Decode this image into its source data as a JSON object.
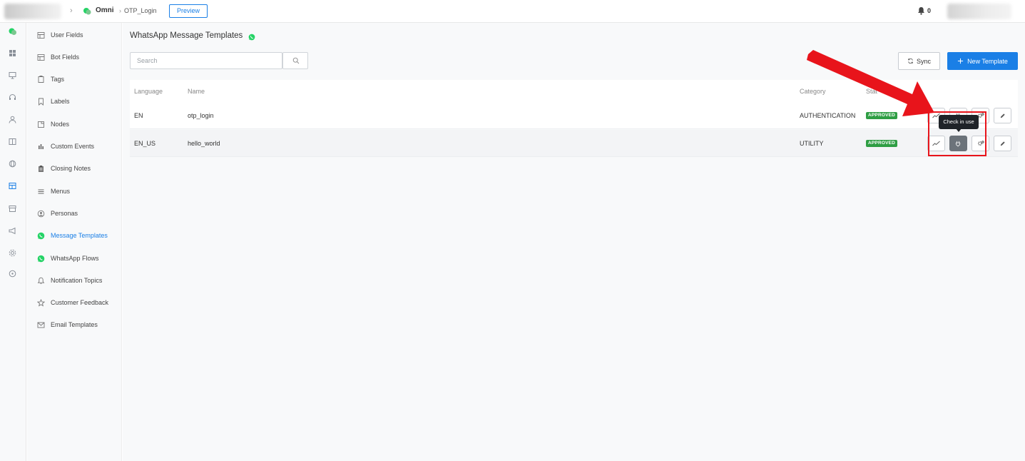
{
  "topbar": {
    "breadcrumb_app": "Omni",
    "breadcrumb_page": "OTP_Login",
    "preview_label": "Preview",
    "notification_count": "0"
  },
  "sidebar": {
    "items": [
      {
        "label": "User Fields",
        "icon": "table-icon"
      },
      {
        "label": "Bot Fields",
        "icon": "table-icon"
      },
      {
        "label": "Tags",
        "icon": "tag-icon"
      },
      {
        "label": "Labels",
        "icon": "bookmark-icon"
      },
      {
        "label": "Nodes",
        "icon": "node-icon"
      },
      {
        "label": "Custom Events",
        "icon": "bar-chart-icon"
      },
      {
        "label": "Closing Notes",
        "icon": "clipboard-icon"
      },
      {
        "label": "Menus",
        "icon": "menu-icon"
      },
      {
        "label": "Personas",
        "icon": "persona-icon"
      },
      {
        "label": "Message Templates",
        "icon": "whatsapp-icon",
        "active": true
      },
      {
        "label": "WhatsApp Flows",
        "icon": "whatsapp-icon"
      },
      {
        "label": "Notification Topics",
        "icon": "bell-icon"
      },
      {
        "label": "Customer Feedback",
        "icon": "star-icon"
      },
      {
        "label": "Email Templates",
        "icon": "mail-icon"
      }
    ]
  },
  "main": {
    "title": "WhatsApp Message Templates",
    "search_placeholder": "Search",
    "sync_label": "Sync",
    "new_template_label": "New Template",
    "columns": {
      "language": "Language",
      "name": "Name",
      "category": "Category",
      "status": "Stat"
    },
    "rows": [
      {
        "language": "EN",
        "name": "otp_login",
        "category": "AUTHENTICATION",
        "status": "APPROVED"
      },
      {
        "language": "EN_US",
        "name": "hello_world",
        "category": "UTILITY",
        "status": "APPROVED"
      }
    ],
    "tooltip": "Check in use"
  },
  "colors": {
    "accent": "#1a7fe6",
    "approved": "#2f9e44",
    "whatsapp": "#25d366",
    "annotation": "#e8141b"
  }
}
